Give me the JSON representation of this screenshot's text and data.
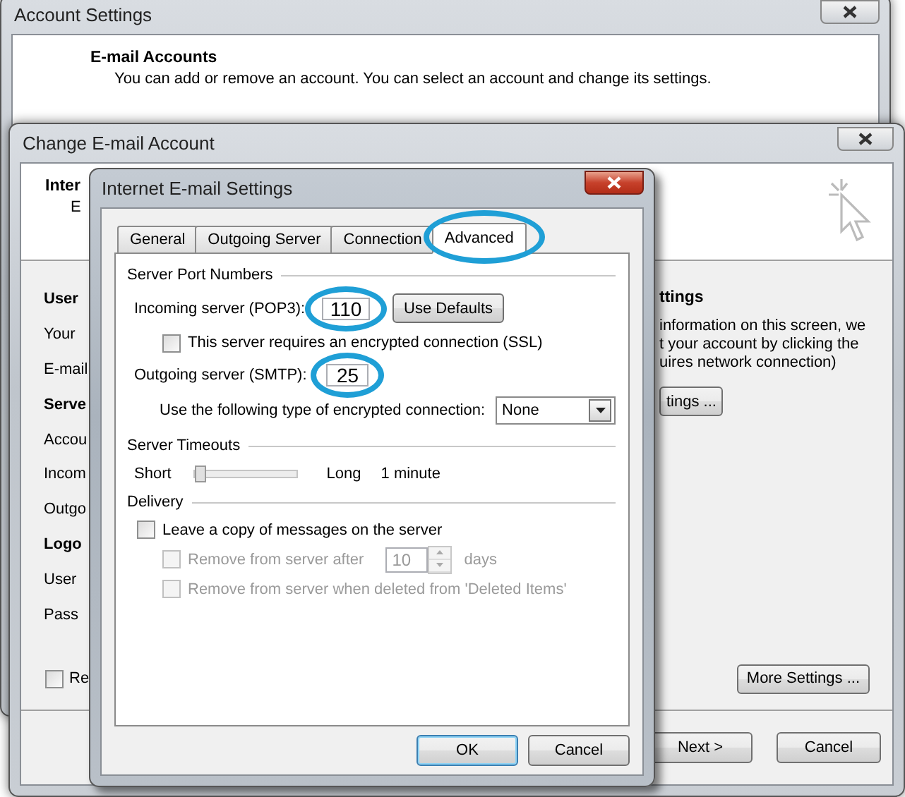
{
  "account_settings": {
    "title": "Account Settings",
    "heading": "E-mail Accounts",
    "description": "You can add or remove an account. You can select an account and change its settings."
  },
  "change_account": {
    "title": "Change E-mail Account",
    "header_title": "Inter",
    "header_subtitle": "E",
    "left_labels": [
      {
        "text": "User",
        "kind": "heading"
      },
      {
        "text": "Your",
        "kind": "label"
      },
      {
        "text": "E-mail",
        "kind": "label"
      },
      {
        "text": "Serve",
        "kind": "heading"
      },
      {
        "text": "Accou",
        "kind": "label"
      },
      {
        "text": "Incom",
        "kind": "label"
      },
      {
        "text": "Outgo",
        "kind": "label"
      },
      {
        "text": "Logo",
        "kind": "heading"
      },
      {
        "text": "User",
        "kind": "label"
      },
      {
        "text": "Pass",
        "kind": "label"
      }
    ],
    "remember_checkbox": {
      "label": "Re",
      "checked": false
    },
    "right_heading": "ttings",
    "right_text": [
      "information on this screen, we",
      "t your account by clicking the",
      "uires network connection)"
    ],
    "test_button": "tings ...",
    "more_settings_button": "More Settings ...",
    "buttons": [
      "Next >",
      "Cancel"
    ]
  },
  "dialog": {
    "title": "Internet E-mail Settings",
    "tabs": [
      {
        "label": "General",
        "selected": false,
        "highlighted": false
      },
      {
        "label": "Outgoing Server",
        "selected": false,
        "highlighted": false
      },
      {
        "label": "Connection",
        "selected": false,
        "highlighted": false
      },
      {
        "label": "Advanced",
        "selected": true,
        "highlighted": true
      }
    ],
    "port_group": "Server Port Numbers",
    "incoming_label": "Incoming server (POP3):",
    "incoming_port": {
      "value": "110",
      "highlighted": true
    },
    "use_defaults_button": "Use Defaults",
    "ssl_checkbox": {
      "label": "This server requires an encrypted connection (SSL)",
      "checked": false
    },
    "outgoing_label": "Outgoing server (SMTP):",
    "outgoing_port": {
      "value": "25",
      "highlighted": true
    },
    "encryption_label": "Use the following type of encrypted connection:",
    "encryption_value": "None",
    "timeout_group": "Server Timeouts",
    "timeout_min": "Short",
    "timeout_slider": {
      "level": 0.04
    },
    "timeout_max": "Long",
    "timeout_value": "1 minute",
    "delivery_group": "Delivery",
    "delivery_options": [
      {
        "kind": "checkbox",
        "label": "Leave a copy of messages on the server",
        "checked": false,
        "disabled": false
      },
      {
        "kind": "days",
        "label": "Remove from server after",
        "days": "10",
        "unit": "days",
        "checked": false,
        "disabled": true
      },
      {
        "kind": "checkbox",
        "label": "Remove from server when deleted from 'Deleted Items'",
        "checked": false,
        "disabled": true
      }
    ],
    "buttons": [
      {
        "label": "OK",
        "default": true
      },
      {
        "label": "Cancel",
        "default": false
      }
    ]
  }
}
